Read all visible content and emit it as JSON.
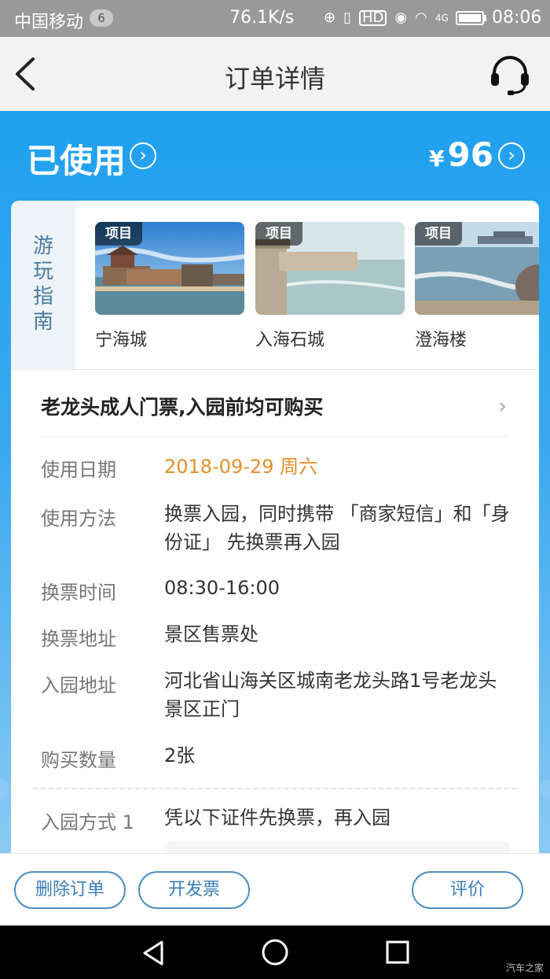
{
  "status_bar": {
    "carrier": "中国移动",
    "sim_badge": "6",
    "net_speed": "76.1K/s",
    "hd_label": "HD",
    "signal_label": "4G",
    "time": "08:06"
  },
  "header": {
    "title": "订单详情",
    "back_icon": "chevron-left-icon",
    "service_icon": "headset-icon"
  },
  "order": {
    "status": "已使用",
    "currency": "¥",
    "price": "96"
  },
  "guide": {
    "label": "游玩指南",
    "items": [
      {
        "tag": "项目",
        "name": "宁海城"
      },
      {
        "tag": "项目",
        "name": "入海石城"
      },
      {
        "tag": "项目",
        "name": "澄海楼"
      }
    ]
  },
  "ticket": {
    "title": "老龙头成人门票,入园前均可购买"
  },
  "details": {
    "use_date": {
      "label": "使用日期",
      "value": "2018-09-29 周六"
    },
    "use_method": {
      "label": "使用方法",
      "value": "换票入园，同时携带 「商家短信」和「身份证」 先换票再入园"
    },
    "exchange_time": {
      "label": "换票时间",
      "value": "08:30-16:00"
    },
    "exchange_address": {
      "label": "换票地址",
      "value": "景区售票处"
    },
    "entry_address": {
      "label": "入园地址",
      "value": "河北省山海关区城南老龙头路1号老龙头景区正门"
    },
    "quantity": {
      "label": "购买数量",
      "value": "2张"
    },
    "entry_method": {
      "label": "入园方式 1",
      "value": "凭以下证件先换票，再入园"
    }
  },
  "actions": {
    "delete": "删除订单",
    "invoice": "开发票",
    "review": "评价"
  },
  "watermark": "汽车之家",
  "colors": {
    "header_blue": "#1fa0ee",
    "accent_orange": "#e0902a",
    "button_blue": "#3a7db6"
  }
}
